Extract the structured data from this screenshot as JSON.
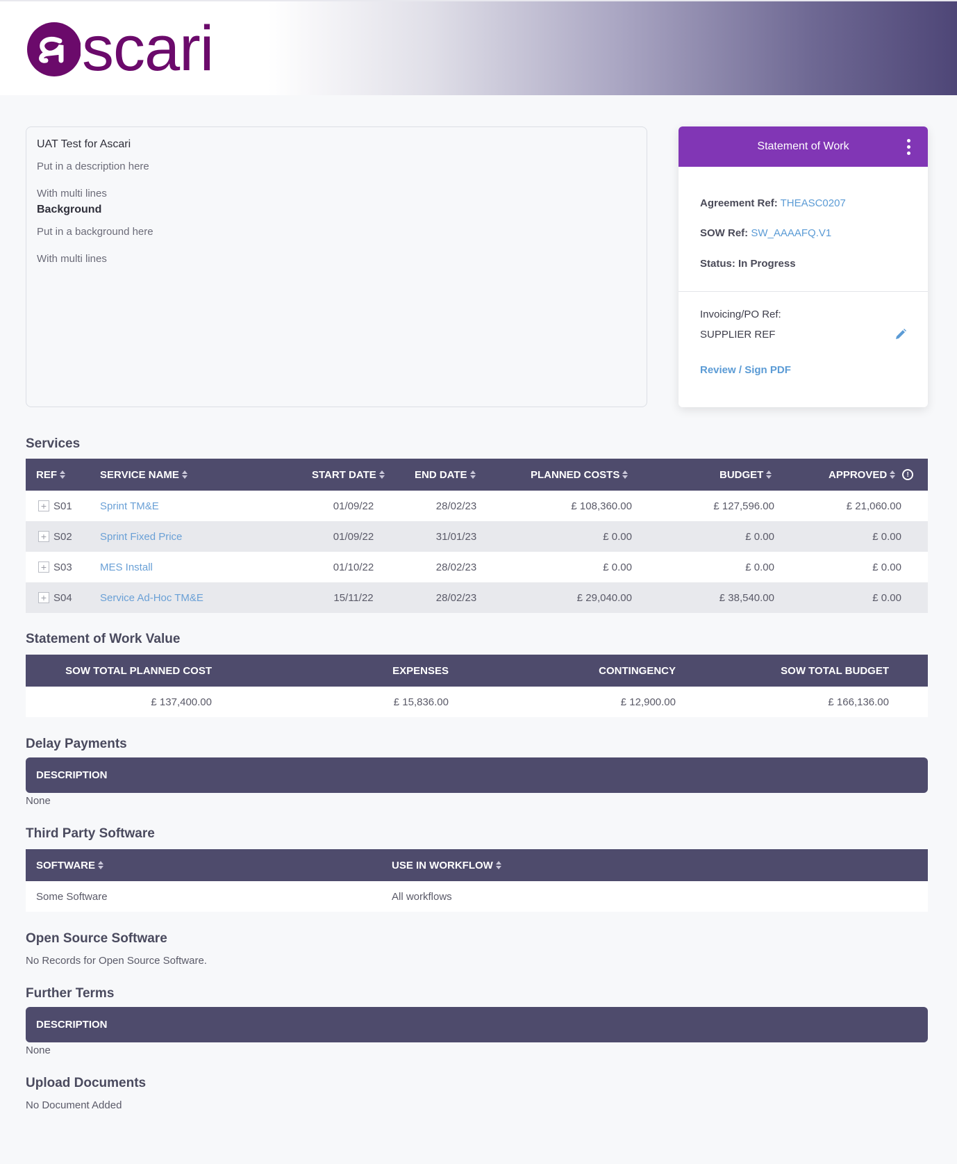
{
  "brand": {
    "name": "ascari",
    "color": "#6b0a6b"
  },
  "description": {
    "title": "UAT Test for Ascari",
    "line1": "Put in a description here",
    "line2": "With multi lines",
    "background_heading": "Background",
    "line3": "Put in a background here",
    "line4": "With multi lines"
  },
  "sow_card": {
    "title": "Statement of Work",
    "agreement_label": "Agreement Ref:",
    "agreement_value": "THEASC0207",
    "sow_label": "SOW Ref:",
    "sow_value": "SW_AAAAFQ.V1",
    "status_label": "Status:",
    "status_value": "In Progress",
    "invoicing_label": "Invoicing/PO Ref:",
    "invoicing_value": "SUPPLIER REF",
    "review_link": "Review / Sign PDF"
  },
  "services": {
    "title": "Services",
    "headers": {
      "ref": "REF",
      "name": "SERVICE NAME",
      "start": "START DATE",
      "end": "END DATE",
      "planned": "PLANNED COSTS",
      "budget": "BUDGET",
      "approved": "APPROVED"
    },
    "rows": [
      {
        "ref": "S01",
        "name": "Sprint TM&E",
        "start": "01/09/22",
        "end": "28/02/23",
        "planned": "£ 108,360.00",
        "budget": "£ 127,596.00",
        "approved": "£ 21,060.00"
      },
      {
        "ref": "S02",
        "name": "Sprint Fixed Price",
        "start": "01/09/22",
        "end": "31/01/23",
        "planned": "£ 0.00",
        "budget": "£ 0.00",
        "approved": "£ 0.00"
      },
      {
        "ref": "S03",
        "name": "MES Install",
        "start": "01/10/22",
        "end": "28/02/23",
        "planned": "£ 0.00",
        "budget": "£ 0.00",
        "approved": "£ 0.00"
      },
      {
        "ref": "S04",
        "name": "Service Ad-Hoc TM&E",
        "start": "15/11/22",
        "end": "28/02/23",
        "planned": "£ 29,040.00",
        "budget": "£ 38,540.00",
        "approved": "£ 0.00"
      }
    ]
  },
  "sow_value": {
    "title": "Statement of Work Value",
    "headers": {
      "planned": "SOW TOTAL PLANNED COST",
      "expenses": "EXPENSES",
      "contingency": "CONTINGENCY",
      "budget": "SOW TOTAL BUDGET"
    },
    "values": {
      "planned": "£ 137,400.00",
      "expenses": "£ 15,836.00",
      "contingency": "£ 12,900.00",
      "budget": "£ 166,136.00"
    }
  },
  "delay_payments": {
    "title": "Delay Payments",
    "header": "DESCRIPTION",
    "empty": "None"
  },
  "third_party": {
    "title": "Third Party Software",
    "headers": {
      "software": "SOFTWARE",
      "workflow": "USE IN WORKFLOW"
    },
    "rows": [
      {
        "software": "Some Software",
        "workflow": "All workflows"
      }
    ]
  },
  "open_source": {
    "title": "Open Source Software",
    "empty": "No Records for Open Source Software."
  },
  "further_terms": {
    "title": "Further Terms",
    "header": "DESCRIPTION",
    "empty": "None"
  },
  "upload": {
    "title": "Upload Documents",
    "empty": "No Document Added"
  }
}
